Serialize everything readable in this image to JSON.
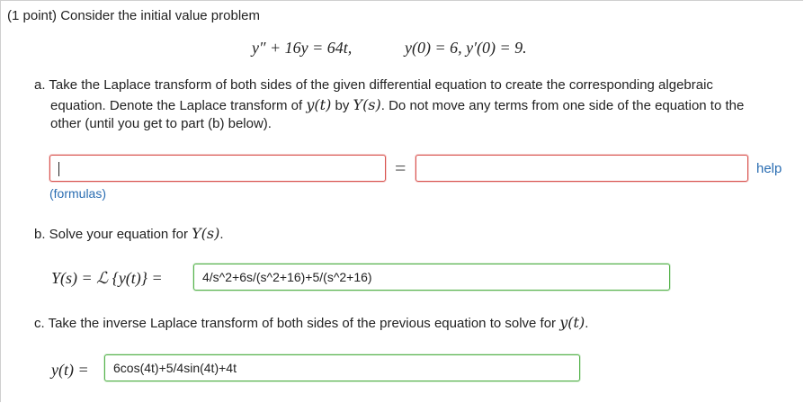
{
  "header": {
    "points": "(1 point)",
    "intro": "Consider the initial value problem"
  },
  "problem": {
    "ode_lhs": "y″ + 16y = 64t,",
    "initial_conditions": "y(0) = 6,   y′(0) = 9."
  },
  "part_a": {
    "line1": "a. Take the Laplace transform of both sides of the given differential equation to create the corresponding algebraic",
    "line2_pre": "equation. Denote the Laplace transform of ",
    "yt": "y(t)",
    "by": " by ",
    "Ys": "Y(s)",
    "line2_post": ". Do not move any terms from one side of the equation to the",
    "line3": "other (until you get to part (b) below).",
    "left_input_value": "",
    "equals": "=",
    "right_input_value": "",
    "help_label": "help",
    "formulas_label": "(formulas)"
  },
  "part_b": {
    "prompt": "b. Solve your equation for ",
    "Ys": "Y(s)",
    "period": ".",
    "lhs": "Y(s) = ℒ {y(t)} =",
    "answer": "4/s^2+6s/(s^2+16)+5/(s^2+16)"
  },
  "part_c": {
    "prompt": "c. Take the inverse Laplace transform of both sides of the previous equation to solve for ",
    "yt": "y(t)",
    "period": ".",
    "lhs": "y(t) =",
    "answer": "6cos(4t)+5/4sin(4t)+4t"
  },
  "colors": {
    "error_border": "#d9534f",
    "correct_border": "#55b24b",
    "link": "#2a6db2"
  }
}
